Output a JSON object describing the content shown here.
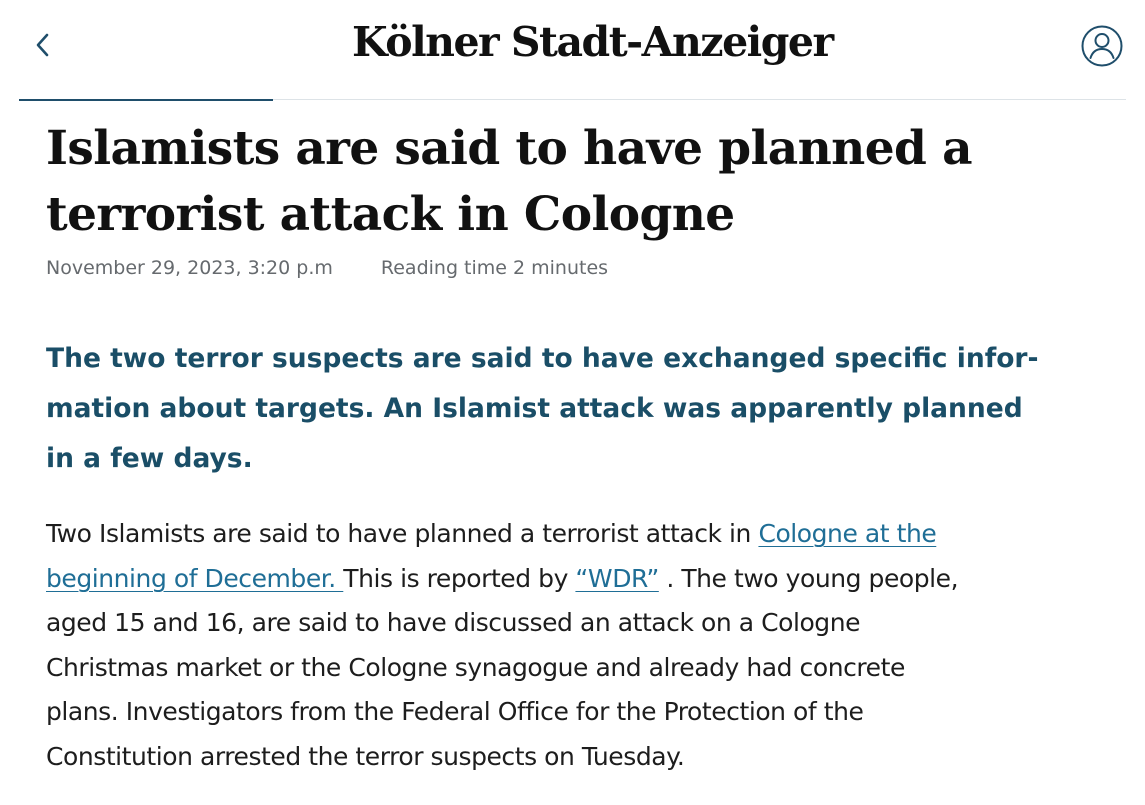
{
  "header": {
    "back_icon": "chevron-left-icon",
    "logo_text": "Kölner Stadt-Anzeiger",
    "account_icon": "user-circle-icon",
    "accent_color": "#1f4e6b"
  },
  "article": {
    "headline_line1": "Islamists are said to have planned a",
    "headline_line2": "terrorist attack in Cologne",
    "date": "November 29, 2023, 3:20 p.m",
    "reading_time": "Reading time 2 minutes",
    "lead_line1": "The two terror suspects are said to have exchanged specific infor-",
    "lead_line2": "mation about targets. An Islamist attack was apparently planned",
    "lead_line3": "in a few days.",
    "body": {
      "text_1": "Two Islamists are said to have planned a terrorist attack in ",
      "link_1_line1": "Cologne at the",
      "link_1_line2": "beginning of December. ",
      "text_2": "This is reported by ",
      "link_2": "“WDR”",
      "text_3": " . The two young people,",
      "line_3": "aged 15 and 16, are said to have discussed an attack on a Cologne",
      "line_4": "Christmas market or the Cologne synagogue and already had concrete",
      "line_5": "plans. Investigators from the Federal Office for the Protection of the",
      "line_6": "Constitution arrested the terror suspects on Tuesday."
    },
    "link_color": "#1f6e96",
    "lead_color": "#1a4e67"
  }
}
